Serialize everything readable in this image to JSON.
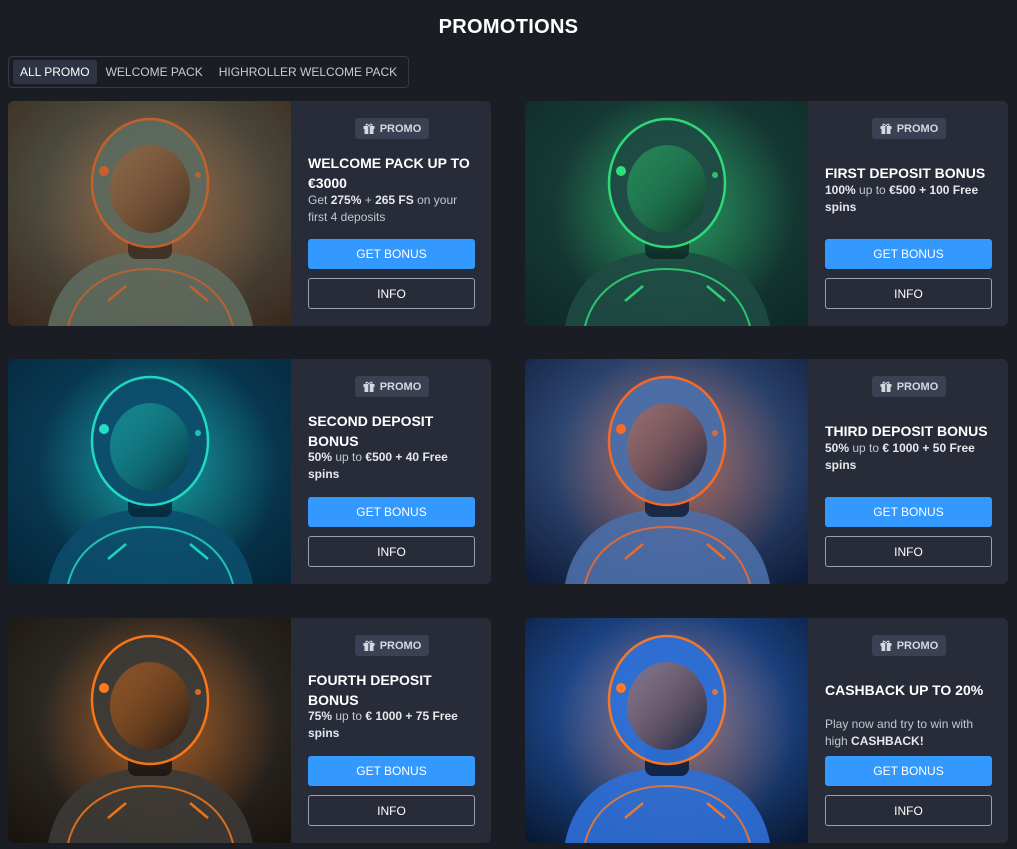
{
  "page": {
    "title": "PROMOTIONS"
  },
  "tabs": [
    {
      "label": "ALL PROMO",
      "active": true
    },
    {
      "label": "WELCOME PACK",
      "active": false
    },
    {
      "label": "HIGHROLLER WELCOME PACK",
      "active": false
    }
  ],
  "promotions": [
    {
      "badge": "PROMO",
      "title": "WELCOME PACK UP TO €3000",
      "desc_parts": [
        "Get ",
        "275%",
        " + ",
        "265 FS",
        " on your first 4 deposits"
      ],
      "get_label": "GET BONUS",
      "info_label": "INFO",
      "theme": [
        "#3a2a1e",
        "#c9622a",
        "#5d6a5e"
      ]
    },
    {
      "badge": "PROMO",
      "title": "FIRST DEPOSIT BONUS",
      "desc_parts": [
        "100%",
        " up to ",
        "€500 + 100 Free spins"
      ],
      "get_label": "GET BONUS",
      "info_label": "INFO",
      "theme": [
        "#0e2a26",
        "#2fe07a",
        "#1f4a44"
      ]
    },
    {
      "badge": "PROMO",
      "title": "SECOND DEPOSIT BONUS",
      "desc_parts": [
        "50%",
        " up to ",
        "€500 + 40 Free spins"
      ],
      "get_label": "GET BONUS",
      "info_label": "INFO",
      "theme": [
        "#05263a",
        "#22e0c8",
        "#0c4d6b"
      ]
    },
    {
      "badge": "PROMO",
      "title": "THIRD DEPOSIT BONUS",
      "desc_parts": [
        "50%",
        " up to ",
        "€ 1000 + 50 Free spins"
      ],
      "get_label": "GET BONUS",
      "info_label": "INFO",
      "theme": [
        "#0f1d3a",
        "#ff6a22",
        "#4b6ea8"
      ]
    },
    {
      "badge": "PROMO",
      "title": "FOURTH DEPOSIT BONUS",
      "desc_parts": [
        "75%",
        " up to ",
        "€ 1000 + 75 Free spins"
      ],
      "get_label": "GET BONUS",
      "info_label": "INFO",
      "theme": [
        "#1a1410",
        "#ff7a18",
        "#3c3a36"
      ]
    },
    {
      "badge": "PROMO",
      "title": "CASHBACK UP TO 20%",
      "desc_parts": [
        "Play now and try to win with high ",
        "CASHBACK!"
      ],
      "get_label": "GET BONUS",
      "info_label": "INFO",
      "theme": [
        "#0a1a36",
        "#ff7a22",
        "#2d6fd6"
      ]
    }
  ],
  "colors": {
    "background": "#1a1d24",
    "card": "#272c38",
    "accent_button": "#3399ff",
    "badge": "#3b4152"
  }
}
